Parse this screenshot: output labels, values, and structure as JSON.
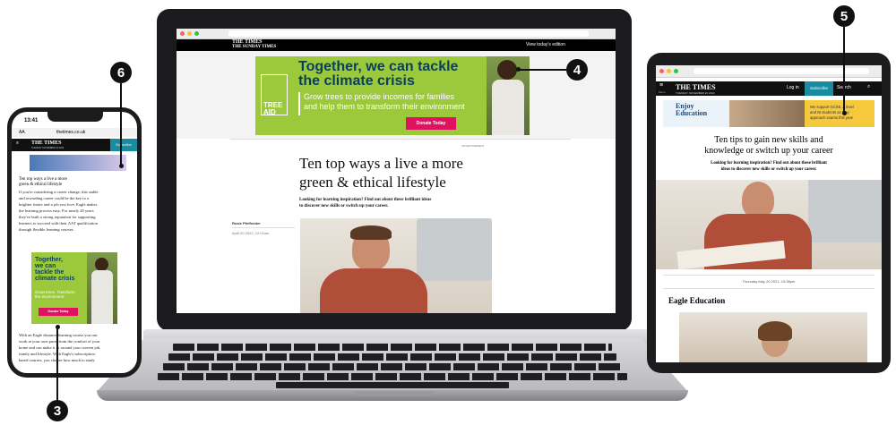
{
  "laptop": {
    "header": {
      "brand_top": "THE TIMES",
      "brand_bottom": "THE SUNDAY TIMES",
      "edition_link": "View today's edition"
    },
    "ad": {
      "headline_line1": "Together, we can tackle",
      "headline_line2": "the climate crisis",
      "body_line1": "Grow trees to provide incomes for families",
      "body_line2": "and help them to transform their environment",
      "cta": "Donate Today",
      "logo_text": "TREE AID"
    },
    "article": {
      "ad_label": "ADVERTISEMENT",
      "title_line1": "Ten top ways a live a more",
      "title_line2": "green & ethical lifestyle",
      "intro_line1": "Looking for learning inspiration? Find out about these brilliant ideas",
      "intro_line2": "to discover new skills or switch up your career.",
      "author": "Rosie Pfeffender",
      "date": "April 20 2022, 12:01am"
    }
  },
  "phone": {
    "status_time": "13:41",
    "url": "thetimes.co.uk",
    "aa": "AA",
    "menu_label": "Menu",
    "brand": "THE TIMES",
    "brand_sub": "TUESDAY NOVEMBER 22 2022",
    "subscribe": "Subscribe",
    "title_line1": "Ten top ways a live a more",
    "title_line2": "green & ethical lifestyle",
    "body": [
      "If you're considering a career change, this stable",
      "and rewarding career could be the key to a",
      "brighter future and a job you love. Eagle makes",
      "the learning process easy. For nearly 20 years",
      "they've built a strong reputation for supporting",
      "learners to succeed with their AAT qualification",
      "through flexible learning courses."
    ],
    "ad_headline": [
      "Together,",
      "we can",
      "tackle the",
      "climate crisis"
    ],
    "ad_body": [
      "Grow trees. Transform",
      "the environment"
    ],
    "ad_cta": "Donate Today",
    "body2": [
      "With an Eagle distance-learning course you can",
      "work at your own pace, from the comfort of your",
      "home and can make it fit around your current job,",
      "family and lifestyle. With Eagle's subscription",
      "based courses, you choose how much to study"
    ]
  },
  "tablet": {
    "menu_label": "Menu",
    "brand": "THE TIMES",
    "brand_sub": "TUESDAY NOVEMBER 22 2022",
    "login": "Log in",
    "subscribe": "Subscribe",
    "search": "Search",
    "ad_brand_line1": "Enjoy",
    "ad_brand_line2": "Education",
    "ad_text": [
      "We support GCSE, A level",
      "and IB students as they",
      "approach exams this year"
    ],
    "title_line1": "Ten tips to gain new skills and",
    "title_line2": "knowledge or switch up your career",
    "intro_line1": "Looking for learning inspiration? Find out about these brilliant",
    "intro_line2": "ideas to discover new skills or switch up your career.",
    "date": "Thursday May 20 2021, 15:38pm",
    "section_heading": "Eagle Education"
  },
  "callouts": [
    "3",
    "4",
    "5",
    "6"
  ]
}
